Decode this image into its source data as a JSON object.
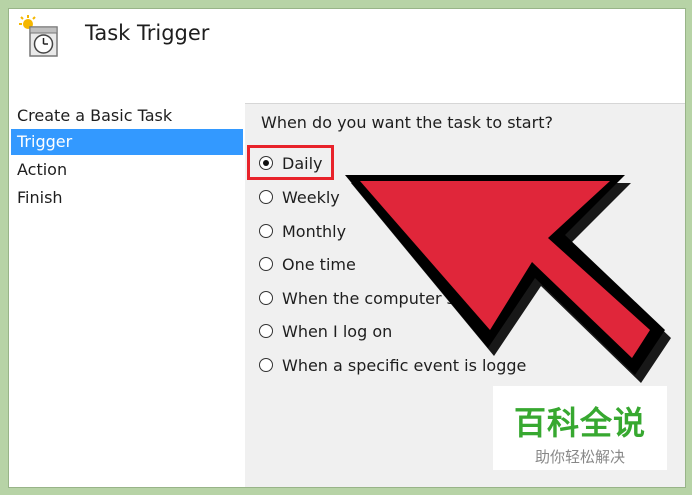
{
  "window": {
    "title": "Task Trigger"
  },
  "sidebar": {
    "items": [
      {
        "label": "Create a Basic Task",
        "selected": false
      },
      {
        "label": "Trigger",
        "selected": true
      },
      {
        "label": "Action",
        "selected": false
      },
      {
        "label": "Finish",
        "selected": false
      }
    ]
  },
  "main": {
    "question": "When do you want the task to start?",
    "options": [
      {
        "label": "Daily",
        "checked": true
      },
      {
        "label": "Weekly",
        "checked": false
      },
      {
        "label": "Monthly",
        "checked": false
      },
      {
        "label": "One time",
        "checked": false
      },
      {
        "label": "When the computer s",
        "checked": false
      },
      {
        "label": "When I log on",
        "checked": false
      },
      {
        "label": "When a specific event is logge",
        "checked": false
      }
    ]
  },
  "overlay": {
    "arrow_color": "#e0263a",
    "highlight_color": "#e8222a"
  },
  "watermark": {
    "title": "百科全说",
    "subtitle": "助你轻松解决"
  },
  "icons": {
    "header": "task-scheduler-clock-icon"
  }
}
